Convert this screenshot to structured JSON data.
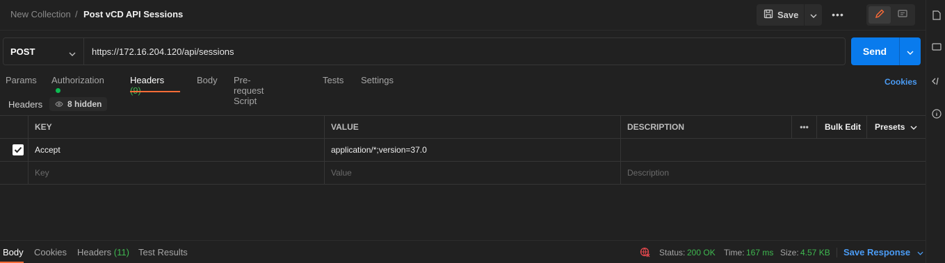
{
  "breadcrumb": {
    "collection": "New Collection",
    "separator": "/",
    "request": "Post vCD API Sessions"
  },
  "toolbar": {
    "save_label": "Save",
    "more_label": "•••"
  },
  "request": {
    "method": "POST",
    "url": "https://172.16.204.120/api/sessions",
    "send_label": "Send"
  },
  "tabs": {
    "params": "Params",
    "authorization": "Authorization",
    "headers": "Headers",
    "headers_count": "(9)",
    "body": "Body",
    "prerequest": "Pre-request Script",
    "tests": "Tests",
    "settings": "Settings",
    "cookies": "Cookies"
  },
  "headers_section": {
    "label": "Headers",
    "hidden_label": "8 hidden"
  },
  "table": {
    "columns": {
      "key": "KEY",
      "value": "VALUE",
      "description": "DESCRIPTION",
      "more": "•••",
      "bulk_edit": "Bulk Edit",
      "presets": "Presets"
    },
    "rows": [
      {
        "checked": true,
        "key": "Accept",
        "value": "application/*;version=37.0",
        "description": ""
      }
    ],
    "placeholders": {
      "key": "Key",
      "value": "Value",
      "description": "Description"
    }
  },
  "response": {
    "tabs": {
      "body": "Body",
      "cookies": "Cookies",
      "headers": "Headers",
      "headers_count": "(11)",
      "test_results": "Test Results"
    },
    "status_label": "Status:",
    "status_value": "200 OK",
    "time_label": "Time:",
    "time_value": "167 ms",
    "size_label": "Size:",
    "size_value": "4.57 KB",
    "save_response": "Save Response"
  },
  "colors": {
    "accent_orange": "#ff6c37",
    "send_blue": "#097bed",
    "link_blue": "#4b9cf5",
    "success_green": "#3fb950",
    "error_red": "#e5484d"
  }
}
